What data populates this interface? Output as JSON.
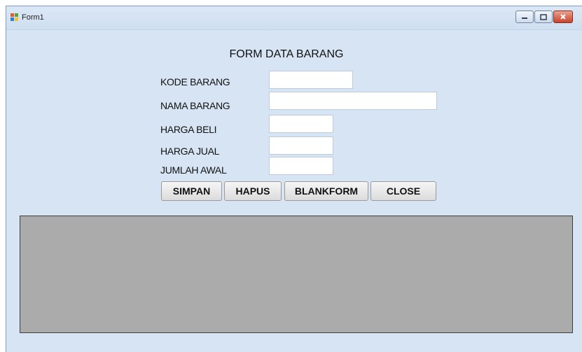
{
  "window": {
    "title": "Form1"
  },
  "form": {
    "heading": "FORM DATA BARANG",
    "fields": [
      {
        "label": "KODE BARANG",
        "value": ""
      },
      {
        "label": "NAMA BARANG",
        "value": ""
      },
      {
        "label": "HARGA BELI",
        "value": ""
      },
      {
        "label": "HARGA JUAL",
        "value": ""
      },
      {
        "label": "JUMLAH AWAL",
        "value": ""
      }
    ],
    "buttons": {
      "simpan": "SIMPAN",
      "hapus": "HAPUS",
      "blankform": "BLANKFORM",
      "close": "CLOSE"
    }
  },
  "colors": {
    "form_background": "#d6e4f3",
    "grid_background": "#ababab",
    "close_button": "#c8432c"
  }
}
